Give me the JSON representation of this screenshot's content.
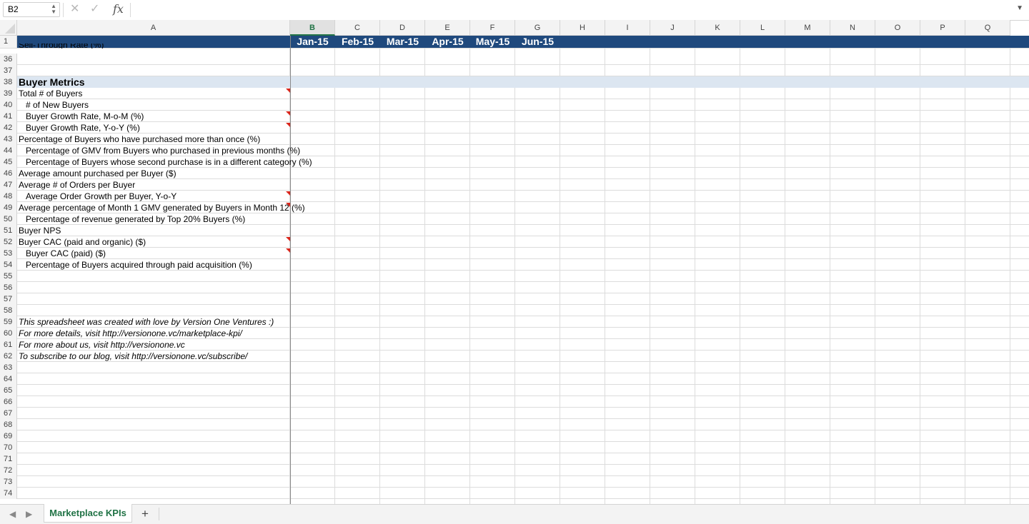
{
  "formula_bar": {
    "name_box": "B2",
    "cancel_icon": "✕",
    "enter_icon": "✓",
    "fx_label": "fx",
    "formula": ""
  },
  "columns": [
    "A",
    "B",
    "C",
    "D",
    "E",
    "F",
    "G",
    "H",
    "I",
    "J",
    "K",
    "L",
    "M",
    "N",
    "O",
    "P",
    "Q"
  ],
  "selected_column": "B",
  "header_row": {
    "row_number": "1",
    "months": [
      "Jan-15",
      "Feb-15",
      "Mar-15",
      "Apr-15",
      "May-15",
      "Jun-15"
    ]
  },
  "partial_row_text": "Sell-Through Rate (%)",
  "rows": [
    {
      "n": "36",
      "text": ""
    },
    {
      "n": "37",
      "text": ""
    },
    {
      "n": "38",
      "text": "Buyer Metrics"
    },
    {
      "n": "39",
      "text": "Total # of Buyers"
    },
    {
      "n": "40",
      "text": "  # of New Buyers"
    },
    {
      "n": "41",
      "text": "  Buyer Growth Rate, M-o-M (%)"
    },
    {
      "n": "42",
      "text": "  Buyer Growth Rate, Y-o-Y (%)"
    },
    {
      "n": "43",
      "text": "Percentage of Buyers who have purchased more than once (%)"
    },
    {
      "n": "44",
      "text": "  Percentage of GMV from Buyers who purchased in previous months (%)"
    },
    {
      "n": "45",
      "text": "  Percentage of Buyers whose second purchase is in a different category (%)"
    },
    {
      "n": "46",
      "text": "Average amount purchased per Buyer ($)"
    },
    {
      "n": "47",
      "text": "Average # of Orders per Buyer"
    },
    {
      "n": "48",
      "text": "  Average Order Growth per Buyer, Y-o-Y"
    },
    {
      "n": "49",
      "text": "Average percentage of Month 1 GMV generated by Buyers in Month 12 (%)"
    },
    {
      "n": "50",
      "text": "  Percentage of revenue generated by Top 20% Buyers (%)"
    },
    {
      "n": "51",
      "text": "Buyer NPS"
    },
    {
      "n": "52",
      "text": "Buyer CAC (paid and organic) ($)"
    },
    {
      "n": "53",
      "text": "  Buyer CAC (paid) ($)"
    },
    {
      "n": "54",
      "text": "  Percentage of Buyers acquired through paid acquisition (%)"
    },
    {
      "n": "55",
      "text": ""
    },
    {
      "n": "56",
      "text": ""
    },
    {
      "n": "57",
      "text": ""
    },
    {
      "n": "58",
      "text": ""
    },
    {
      "n": "59",
      "text": "This spreadsheet was created with love by Version One Ventures :)"
    },
    {
      "n": "60",
      "text": "For more details, visit http://versionone.vc/marketplace-kpi/"
    },
    {
      "n": "61",
      "text": "For more about us, visit http://versionone.vc"
    },
    {
      "n": "62",
      "text": "To subscribe to our blog, visit http://versionone.vc/subscribe/"
    },
    {
      "n": "63",
      "text": ""
    },
    {
      "n": "64",
      "text": ""
    },
    {
      "n": "65",
      "text": ""
    },
    {
      "n": "66",
      "text": ""
    },
    {
      "n": "67",
      "text": ""
    },
    {
      "n": "68",
      "text": ""
    },
    {
      "n": "69",
      "text": ""
    },
    {
      "n": "70",
      "text": ""
    },
    {
      "n": "71",
      "text": ""
    },
    {
      "n": "72",
      "text": ""
    },
    {
      "n": "73",
      "text": ""
    },
    {
      "n": "74",
      "text": ""
    }
  ],
  "sheet_tabs": {
    "active": "Marketplace KPIs",
    "add_label": "+"
  },
  "colors": {
    "header_band": "#1f497d",
    "section_band": "#dce6f1",
    "accent": "#217346",
    "comment_marker": "#d9261c"
  }
}
